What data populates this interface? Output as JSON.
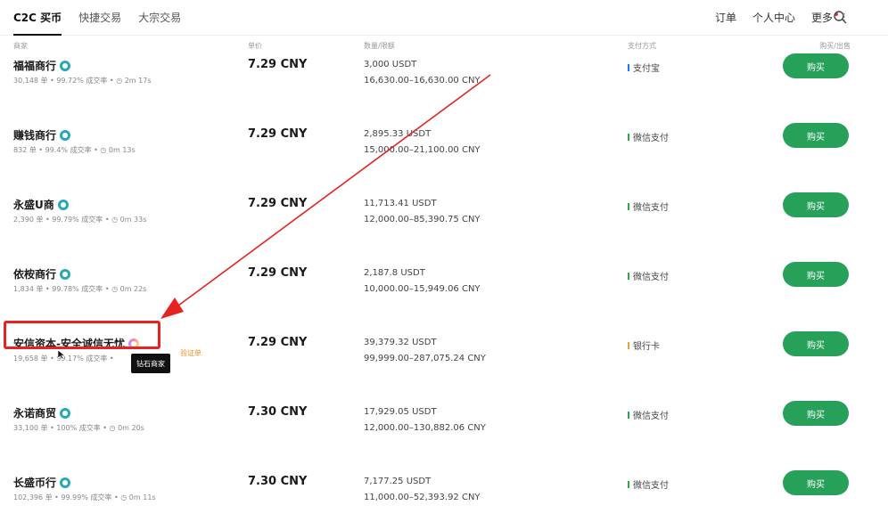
{
  "nav": {
    "tabs": [
      {
        "label": "C2C 买币",
        "active": true
      },
      {
        "label": "快捷交易",
        "active": false
      },
      {
        "label": "大宗交易",
        "active": false
      }
    ],
    "links": {
      "orders": "订单",
      "personal_center": "个人中心",
      "more": "更多"
    },
    "more_dots": "⋮"
  },
  "columns": {
    "merchant": "商家",
    "price": "单价",
    "amount_limit": "数量/限额",
    "payment": "支付方式",
    "action": "购买/出售"
  },
  "rows": [
    {
      "merchant": "福福商行",
      "stats": "30,148 单  •  99.72% 成交率  •  ◷ 2m 17s",
      "price": "7.29 CNY",
      "amount": "3,000 USDT",
      "limit": "16,630.00–16,630.00 CNY",
      "payment": "支付宝",
      "button": "购买"
    },
    {
      "merchant": "赚钱商行",
      "stats": "832 单  •  99.4% 成交率  •  ◷ 0m 13s",
      "price": "7.29 CNY",
      "amount": "2,895.33 USDT",
      "limit": "15,000.00–21,100.00 CNY",
      "payment": "微信支付",
      "button": "购买"
    },
    {
      "merchant": "永盛U商",
      "stats": "2,390 单  •  99.79% 成交率  •  ◷ 0m 33s",
      "price": "7.29 CNY",
      "amount": "11,713.41 USDT",
      "limit": "12,000.00–85,390.75 CNY",
      "payment": "微信支付",
      "button": "购买"
    },
    {
      "merchant": "依桉商行",
      "stats": "1,834 单  •  99.78% 成交率  •  ◷ 0m 22s",
      "price": "7.29 CNY",
      "amount": "2,187.8 USDT",
      "limit": "10,000.00–15,949.06 CNY",
      "payment": "微信支付",
      "button": "购买"
    },
    {
      "merchant": "安信资本-安全诚信无忧",
      "stats": "19,658 单  •  99.17% 成交率  •",
      "price": "7.29 CNY",
      "amount": "39,379.32 USDT",
      "limit": "99,999.00–287,075.24 CNY",
      "payment": "银行卡",
      "button": "购买"
    },
    {
      "merchant": "永诺商贸",
      "stats": "33,100 单  •  100% 成交率  •  ◷ 0m 20s",
      "price": "7.30 CNY",
      "amount": "17,929.05 USDT",
      "limit": "12,000.00–130,882.06 CNY",
      "payment": "微信支付",
      "button": "购买"
    },
    {
      "merchant": "长盛币行",
      "stats": "102,396 单  •  99.99% 成交率  •  ◷ 0m 11s",
      "price": "7.30 CNY",
      "amount": "7,177.25 USDT",
      "limit": "11,000.00–52,393.92 CNY",
      "payment": "微信支付",
      "button": "购买"
    }
  ],
  "tooltip": "钻石商家",
  "verify_tag": "验证单",
  "colors": {
    "buy_green": "#27a05a",
    "annotation_red": "#e52420",
    "badge_teal": "#2aa8b8",
    "verify_orange": "#f0932b",
    "more_dot_red": "#e8333a",
    "pay_wechat": "#2aa84a",
    "pay_alipay": "#1677ff",
    "pay_bank": "#e8a33a"
  }
}
